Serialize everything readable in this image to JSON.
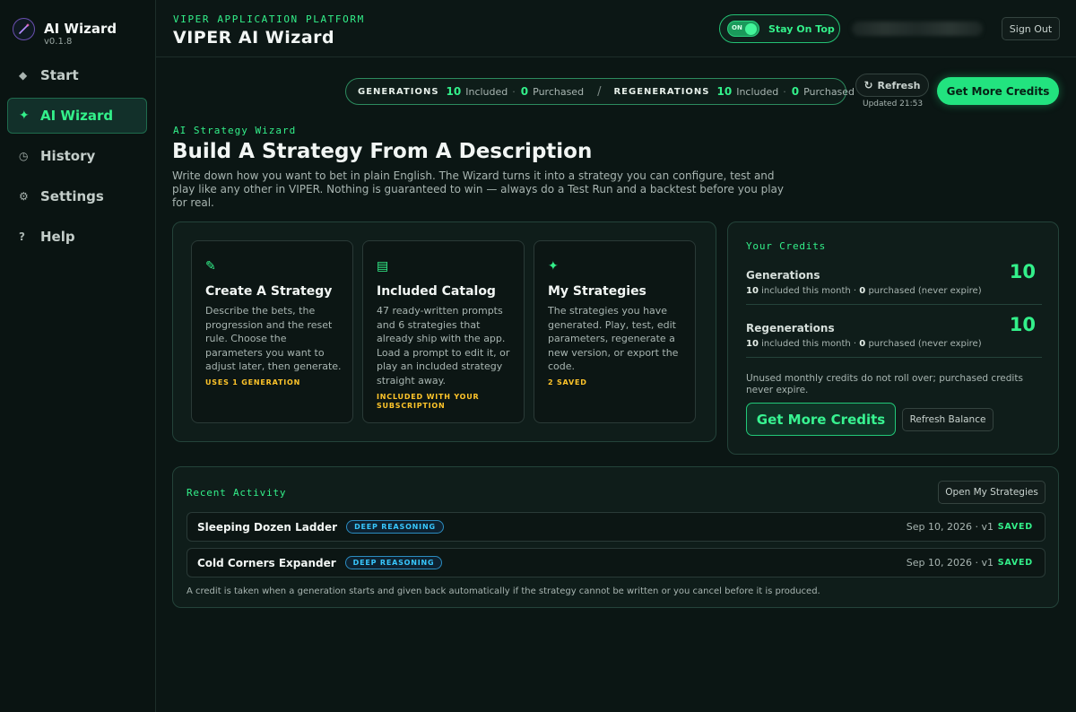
{
  "brand": {
    "title": "AI Wizard",
    "version": "v0.1.8",
    "icon": "wand-icon"
  },
  "nav": [
    {
      "label": "Start",
      "icon": "diamond-icon",
      "glyph": "◆",
      "active": false
    },
    {
      "label": "AI Wizard",
      "icon": "sparkle-icon",
      "glyph": "✦",
      "active": true
    },
    {
      "label": "History",
      "icon": "clock-icon",
      "glyph": "◷",
      "active": false
    },
    {
      "label": "Settings",
      "icon": "gear-icon",
      "glyph": "⚙",
      "active": false
    },
    {
      "label": "Help",
      "icon": "question-icon",
      "glyph": "?",
      "active": false
    }
  ],
  "header": {
    "kicker": "VIPER APPLICATION PLATFORM",
    "title": "VIPER AI Wizard",
    "toggle_state": "ON",
    "toggle_label": "Stay On Top",
    "sign_out": "Sign Out"
  },
  "credits_bar": {
    "gen_label": "GENERATIONS",
    "gen_included": "10",
    "included_text": "Included",
    "gen_purchased": "0",
    "purchased_text": "Purchased",
    "slash": "/",
    "regen_label": "REGENERATIONS",
    "regen_included": "10",
    "regen_purchased": "0",
    "dot": "·",
    "refresh": "Refresh",
    "updated": "Updated 21:53",
    "get_more": "Get More Credits"
  },
  "intro": {
    "kicker": "AI Strategy Wizard",
    "title": "Build A Strategy From A Description",
    "description": "Write down how you want to bet in plain English. The Wizard turns it into a strategy you can configure, test and play like any other in VIPER. Nothing is guaranteed to win — always do a Test Run and a backtest before you play for real."
  },
  "cards": [
    {
      "icon": "pencil-icon",
      "glyph": "✎",
      "title": "Create A Strategy",
      "desc": "Describe the bets, the progression and the reset rule. Choose the parameters you want to adjust later, then generate.",
      "tag": "USES 1 GENERATION"
    },
    {
      "icon": "list-icon",
      "glyph": "▤",
      "title": "Included Catalog",
      "desc": "47 ready-written prompts and 6 strategies that already ship with the app. Load a prompt to edit it, or play an included strategy straight away.",
      "tag": "INCLUDED WITH YOUR SUBSCRIPTION"
    },
    {
      "icon": "sparkle-icon",
      "glyph": "✦",
      "title": "My Strategies",
      "desc": "The strategies you have generated. Play, test, edit parameters, regenerate a new version, or export the code.",
      "tag": "2 SAVED"
    }
  ],
  "your_credits": {
    "kicker": "Your Credits",
    "gen_label": "Generations",
    "gen_total": "10",
    "gen_included": "10",
    "gen_included_text": "included this month ·",
    "gen_purchased": "0",
    "gen_purchased_text": "purchased (never expire)",
    "regen_label": "Regenerations",
    "regen_total": "10",
    "regen_included": "10",
    "regen_included_text": "included this month ·",
    "regen_purchased": "0",
    "regen_purchased_text": "purchased (never expire)",
    "note": "Unused monthly credits do not roll over; purchased credits never expire.",
    "get_more": "Get More Credits",
    "refresh": "Refresh Balance"
  },
  "activity": {
    "kicker": "Recent Activity",
    "open": "Open My Strategies",
    "rows": [
      {
        "name": "Sleeping Dozen Ladder",
        "badge": "DEEP REASONING",
        "date": "Sep 10, 2026 · v1",
        "status": "SAVED"
      },
      {
        "name": "Cold Corners Expander",
        "badge": "DEEP REASONING",
        "date": "Sep 10, 2026 · v1",
        "status": "SAVED"
      }
    ],
    "note": "A credit is taken when a generation starts and given back automatically if the strategy cannot be written or you cancel before it is produced."
  },
  "colors": {
    "accent": "#33f08a",
    "warning": "#ffc52a",
    "info": "#38c8ff",
    "background": "#0b1614"
  }
}
